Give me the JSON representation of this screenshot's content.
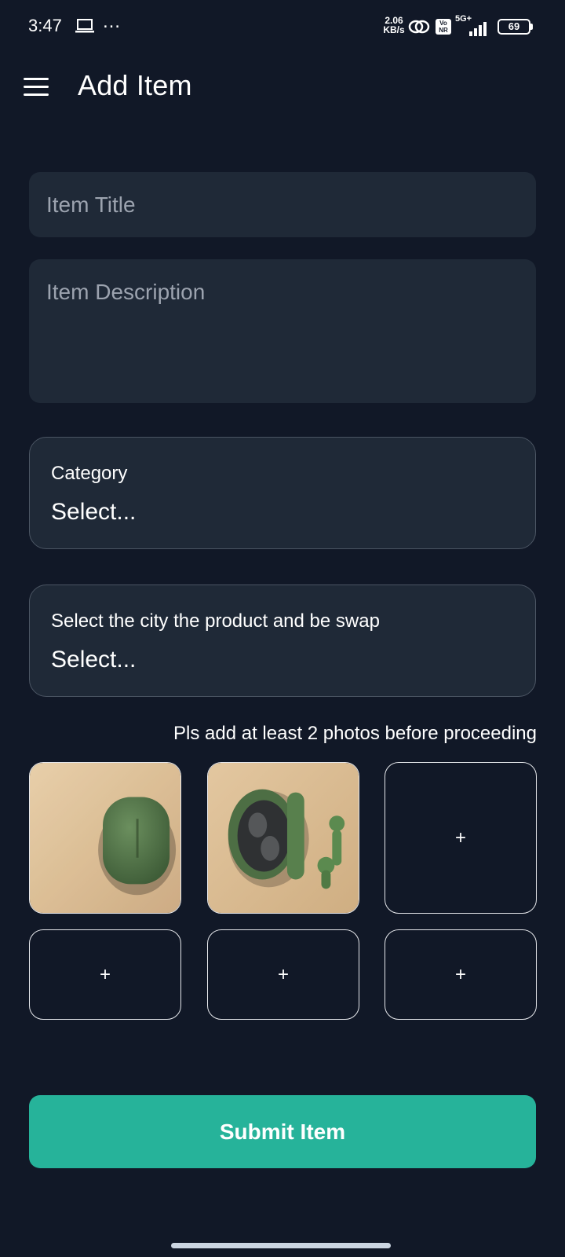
{
  "status_bar": {
    "time": "3:47",
    "more_icon": "…",
    "net_speed_value": "2.06",
    "net_speed_unit": "KB/s",
    "vonr_label_top": "Vo",
    "vonr_label_bottom": "NR",
    "network_label": "5G+",
    "battery_level": "69",
    "icons": [
      "laptop-icon",
      "hotspot-icon",
      "signal-icon",
      "battery-icon"
    ]
  },
  "app_bar": {
    "title": "Add Item",
    "menu_icon": "hamburger-menu-icon"
  },
  "form": {
    "title_placeholder": "Item Title",
    "description_placeholder": "Item Description",
    "category": {
      "label": "Category",
      "value": "Select..."
    },
    "city": {
      "label": "Select the city the product and be swap",
      "value": "Select..."
    },
    "photo_hint": "Pls add at least 2 photos before proceeding",
    "add_photo_symbol": "+",
    "photos": [
      {
        "filled": true,
        "subject": "closed-green-earbuds-case"
      },
      {
        "filled": true,
        "subject": "open-green-earbuds-case"
      },
      {
        "filled": false
      },
      {
        "filled": false
      },
      {
        "filled": false
      },
      {
        "filled": false
      }
    ],
    "submit_label": "Submit Item"
  },
  "colors": {
    "background": "#111827",
    "surface": "#1f2937",
    "placeholder": "#9ca3af",
    "accent": "#26b39a",
    "border": "#4b5563"
  }
}
